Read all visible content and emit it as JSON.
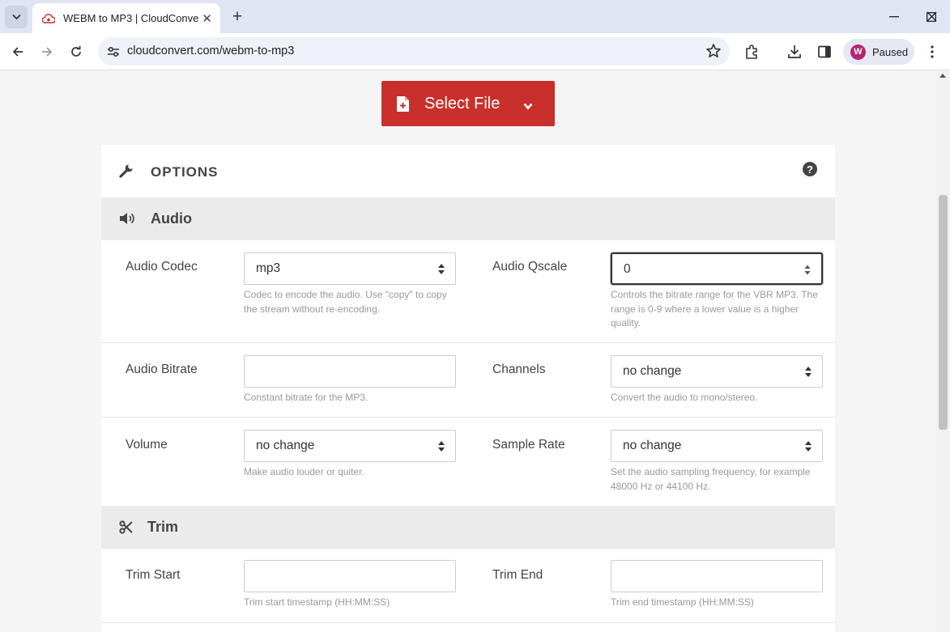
{
  "browser": {
    "tab_title": "WEBM to MP3 | CloudConvert",
    "tab_close": "✕",
    "new_tab": "+",
    "url": "cloudconvert.com/webm-to-mp3",
    "profile_initial": "W",
    "profile_status": "Paused",
    "icons": [
      "tab-search-icon",
      "cloudconvert-favicon",
      "back-icon",
      "forward-icon",
      "reload-icon",
      "site-settings-icon",
      "bookmark-star-icon",
      "extensions-icon",
      "download-icon",
      "side-panel-icon",
      "more-menu-icon",
      "minimize-icon",
      "maximize-icon",
      "close-window-icon"
    ]
  },
  "page": {
    "select_file_label": "Select File",
    "options_title": "OPTIONS",
    "options_help": "?",
    "accent_color": "#c9302c",
    "audio_section": {
      "title": "Audio",
      "fields": {
        "audio_codec": {
          "label": "Audio Codec",
          "value": "mp3",
          "help": "Codec to encode the audio. Use \"copy\" to copy the stream without re-encoding."
        },
        "audio_qscale": {
          "label": "Audio Qscale",
          "value": "0",
          "help": "Controls the bitrate range for the VBR MP3. The range is 0-9 where a lower value is a higher quality."
        },
        "audio_bitrate": {
          "label": "Audio Bitrate",
          "value": "",
          "help": "Constant bitrate for the MP3."
        },
        "channels": {
          "label": "Channels",
          "value": "no change",
          "help": "Convert the audio to mono/stereo."
        },
        "volume": {
          "label": "Volume",
          "value": "no change",
          "help": "Make audio louder or quiter."
        },
        "sample_rate": {
          "label": "Sample Rate",
          "value": "no change",
          "help": "Set the audio sampling frequency, for example 48000 Hz or 44100 Hz."
        }
      }
    },
    "trim_section": {
      "title": "Trim",
      "fields": {
        "trim_start": {
          "label": "Trim Start",
          "value": "",
          "help": "Trim start timestamp (HH:MM:SS)"
        },
        "trim_end": {
          "label": "Trim End",
          "value": "",
          "help": "Trim end timestamp (HH:MM:SS)"
        }
      }
    }
  }
}
